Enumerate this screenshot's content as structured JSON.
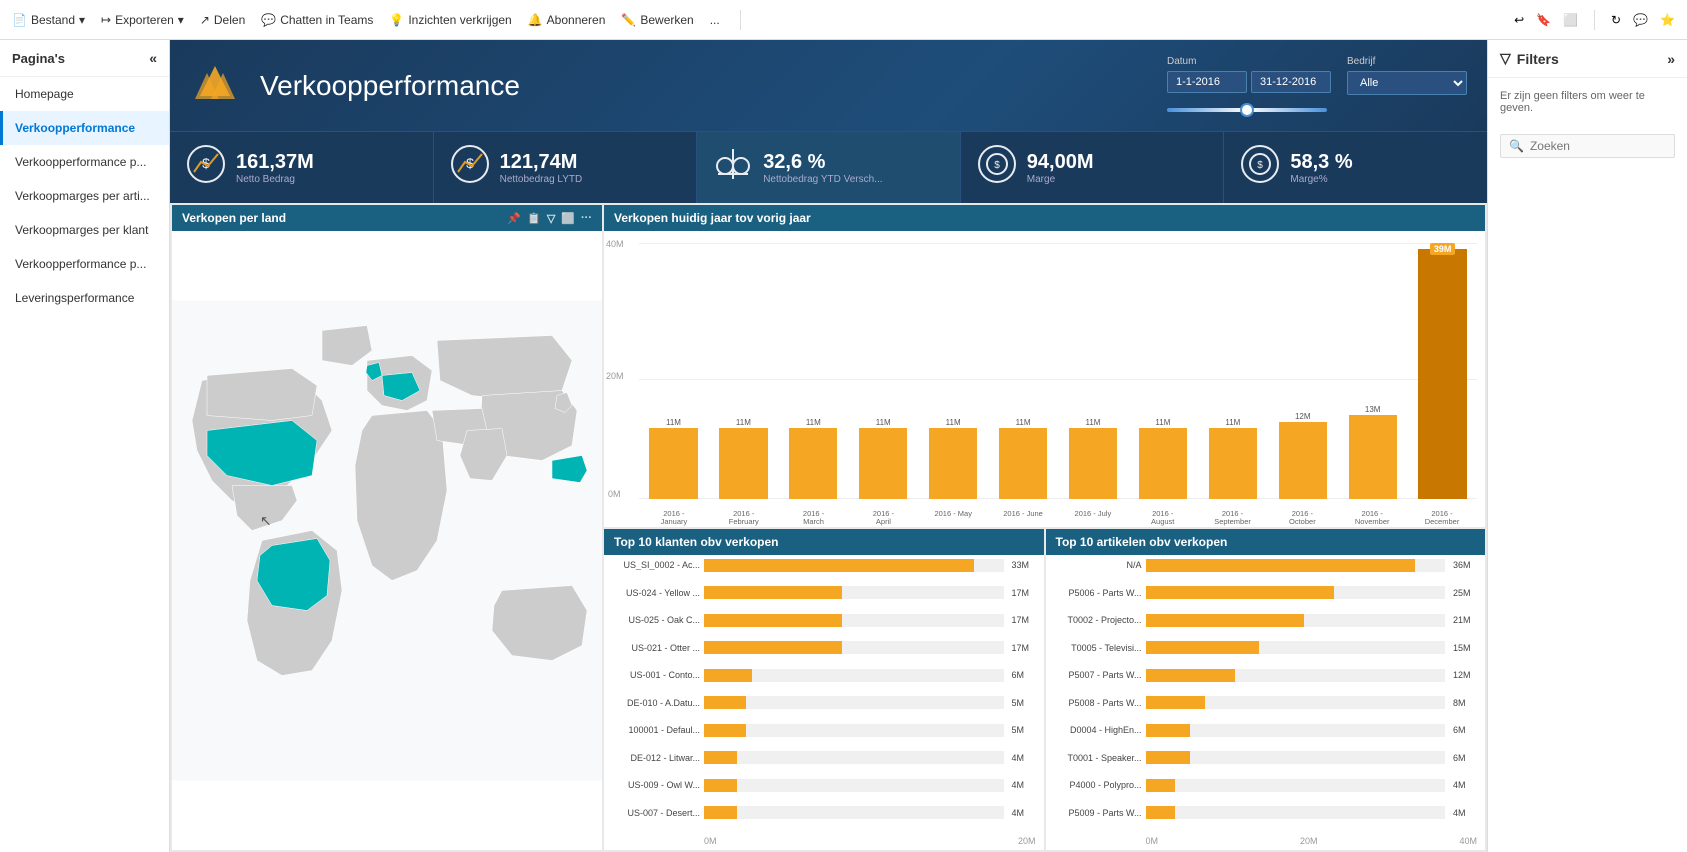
{
  "toolbar": {
    "items": [
      {
        "label": "Bestand",
        "icon": "📄",
        "has_dropdown": true
      },
      {
        "label": "Exporteren",
        "icon": "↦",
        "has_dropdown": true
      },
      {
        "label": "Delen",
        "icon": "↗",
        "has_dropdown": false
      },
      {
        "label": "Chatten in Teams",
        "icon": "💬",
        "has_dropdown": false
      },
      {
        "label": "Inzichten verkrijgen",
        "icon": "💡",
        "has_dropdown": false
      },
      {
        "label": "Abonneren",
        "icon": "🔔",
        "has_dropdown": false
      },
      {
        "label": "Bewerken",
        "icon": "✏️",
        "has_dropdown": false
      },
      {
        "label": "...",
        "icon": "",
        "has_dropdown": false
      }
    ],
    "right_icons": [
      "↩",
      "🔖",
      "⬜",
      "↻",
      "💬",
      "⭐"
    ]
  },
  "sidebar": {
    "title": "Pagina's",
    "items": [
      {
        "label": "Homepage",
        "active": false
      },
      {
        "label": "Verkoopperformance",
        "active": true
      },
      {
        "label": "Verkoopperformance p...",
        "active": false
      },
      {
        "label": "Verkoopmarges per arti...",
        "active": false
      },
      {
        "label": "Verkoopmarges per klant",
        "active": false
      },
      {
        "label": "Verkoopperformance p...",
        "active": false
      },
      {
        "label": "Leveringsperformance",
        "active": false
      }
    ]
  },
  "dashboard": {
    "title": "Verkoopperformance",
    "filters": {
      "datum_label": "Datum",
      "datum_from": "1-1-2016",
      "datum_to": "31-12-2016",
      "bedrijf_label": "Bedrijf",
      "bedrijf_value": "Alle"
    },
    "kpis": [
      {
        "value": "161,37M",
        "label": "Netto Bedrag",
        "icon": "💰",
        "highlighted": false
      },
      {
        "value": "121,74M",
        "label": "Nettobedrag LYTD",
        "icon": "📈",
        "highlighted": false
      },
      {
        "value": "32,6 %",
        "label": "Nettobedrag YTD Versch...",
        "icon": "⚖️",
        "highlighted": true
      },
      {
        "value": "94,00M",
        "label": "Marge",
        "icon": "💿",
        "highlighted": false
      },
      {
        "value": "58,3 %",
        "label": "Marge%",
        "icon": "💿",
        "highlighted": false
      }
    ]
  },
  "map_chart": {
    "title": "Verkopen per land",
    "header_icons": [
      "📌",
      "📋",
      "🔽",
      "⬜",
      "..."
    ]
  },
  "bar_chart": {
    "title": "Verkopen huidig jaar tov vorig jaar",
    "y_labels": [
      "40M",
      "20M",
      "0M"
    ],
    "bars": [
      {
        "label": "2016 -\nJanuary",
        "value": 11,
        "max": 40,
        "display": "11M"
      },
      {
        "label": "2016 -\nFebruary",
        "value": 11,
        "max": 40,
        "display": "11M"
      },
      {
        "label": "2016 -\nMarch",
        "value": 11,
        "max": 40,
        "display": "11M"
      },
      {
        "label": "2016 -\nApril",
        "value": 11,
        "max": 40,
        "display": "11M"
      },
      {
        "label": "2016 - May",
        "value": 11,
        "max": 40,
        "display": "11M"
      },
      {
        "label": "2016 - June",
        "value": 11,
        "max": 40,
        "display": "11M"
      },
      {
        "label": "2016 - July",
        "value": 11,
        "max": 40,
        "display": "11M"
      },
      {
        "label": "2016 -\nAugust",
        "value": 11,
        "max": 40,
        "display": "11M"
      },
      {
        "label": "2016 -\nSeptember",
        "value": 11,
        "max": 40,
        "display": "11M"
      },
      {
        "label": "2016 -\nOctober",
        "value": 12,
        "max": 40,
        "display": "12M"
      },
      {
        "label": "2016 -\nNovember",
        "value": 13,
        "max": 40,
        "display": "13M"
      },
      {
        "label": "2016 -\nDecember",
        "value": 39,
        "max": 40,
        "display": "39M",
        "highlight": true
      }
    ]
  },
  "top10_customers": {
    "title": "Top 10  klanten obv verkopen",
    "bars": [
      {
        "label": "US_SI_0002 - Ac...",
        "value": 33,
        "max": 20,
        "display": "33M",
        "pct": 90
      },
      {
        "label": "US-024 - Yellow ...",
        "value": 17,
        "max": 20,
        "display": "17M",
        "pct": 46
      },
      {
        "label": "US-025 - Oak C...",
        "value": 17,
        "max": 20,
        "display": "17M",
        "pct": 46
      },
      {
        "label": "US-021 - Otter ...",
        "value": 17,
        "max": 20,
        "display": "17M",
        "pct": 46
      },
      {
        "label": "US-001 - Conto...",
        "value": 6,
        "max": 20,
        "display": "6M",
        "pct": 16
      },
      {
        "label": "DE-010 - A.Datu...",
        "value": 5,
        "max": 20,
        "display": "5M",
        "pct": 14
      },
      {
        "label": "100001 - Defaul...",
        "value": 5,
        "max": 20,
        "display": "5M",
        "pct": 14
      },
      {
        "label": "DE-012 - Litwar...",
        "value": 4,
        "max": 20,
        "display": "4M",
        "pct": 11
      },
      {
        "label": "US-009 - Owl W...",
        "value": 4,
        "max": 20,
        "display": "4M",
        "pct": 11
      },
      {
        "label": "US-007 - Desert...",
        "value": 4,
        "max": 20,
        "display": "4M",
        "pct": 11
      }
    ],
    "x_labels": [
      "0M",
      "20M"
    ]
  },
  "top10_articles": {
    "title": "Top 10 artikelen obv verkopen",
    "bars": [
      {
        "label": "N/A",
        "value": 36,
        "max": 40,
        "display": "36M",
        "pct": 90
      },
      {
        "label": "P5006 - Parts W...",
        "value": 25,
        "max": 40,
        "display": "25M",
        "pct": 63
      },
      {
        "label": "T0002 - Projecto...",
        "value": 21,
        "max": 40,
        "display": "21M",
        "pct": 53
      },
      {
        "label": "T0005 - Televisi...",
        "value": 15,
        "max": 40,
        "display": "15M",
        "pct": 38
      },
      {
        "label": "P5007 - Parts W...",
        "value": 12,
        "max": 40,
        "display": "12M",
        "pct": 30
      },
      {
        "label": "P5008 - Parts W...",
        "value": 8,
        "max": 40,
        "display": "8M",
        "pct": 20
      },
      {
        "label": "D0004 - HighEn...",
        "value": 6,
        "max": 40,
        "display": "6M",
        "pct": 15
      },
      {
        "label": "T0001 - Speaker...",
        "value": 6,
        "max": 40,
        "display": "6M",
        "pct": 15
      },
      {
        "label": "P4000 - Polypro...",
        "value": 4,
        "max": 40,
        "display": "4M",
        "pct": 10
      },
      {
        "label": "P5009 - Parts W...",
        "value": 4,
        "max": 40,
        "display": "4M",
        "pct": 10
      }
    ],
    "x_labels": [
      "0M",
      "20M",
      "40M"
    ]
  },
  "right_panel": {
    "title": "Filters",
    "expand_icon": "»",
    "empty_message": "Er zijn geen filters om weer te geven."
  },
  "colors": {
    "bar_orange": "#f5a623",
    "teal_header": "#1a6080",
    "dark_blue": "#1a3a5c",
    "highlight_orange": "#e8960e",
    "active_sidebar": "#0078d4"
  }
}
